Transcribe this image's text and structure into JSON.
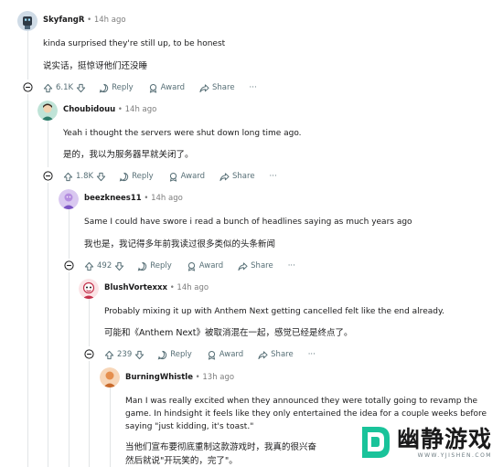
{
  "comments": [
    {
      "user": "SkyfangR",
      "time": "14h ago",
      "text_en": "kinda surprised they're still up, to be honest",
      "text_zh": "说实话，挺惊讶他们还没睡",
      "votes": "6.1K"
    },
    {
      "user": "Choubidouu",
      "time": "14h ago",
      "text_en": "Yeah i thought the servers were shut down long time ago.",
      "text_zh": "是的，我以为服务器早就关闭了。",
      "votes": "1.8K"
    },
    {
      "user": "beezknees11",
      "time": "14h ago",
      "text_en": "Same I could have swore i read a bunch of headlines saying as much years ago",
      "text_zh": "我也是，我记得多年前我读过很多类似的头条新闻",
      "votes": "492"
    },
    {
      "user": "BlushVortexxx",
      "time": "14h ago",
      "text_en": "Probably mixing it up with Anthem Next getting cancelled felt like the end already.",
      "text_zh": "可能和《Anthem Next》被取消混在一起，感觉已经是终点了。",
      "votes": "239"
    },
    {
      "user": "BurningWhistle",
      "time": "13h ago",
      "text_en_1": "Man I was really excited when they announced they were totally going to revamp the",
      "text_en_2": "game. In hindsight it feels like they only entertained the idea for a couple weeks before",
      "text_en_3": "saying \"just kidding, it's toast.\"",
      "text_zh_1": "当他们宣布要彻底重制这款游戏时，我真的很兴奋",
      "text_zh_2": "然后就说\"开玩笑的，完了\"。"
    }
  ],
  "actions": {
    "reply": "Reply",
    "award": "Award",
    "share": "Share",
    "more": "···",
    "sep": "•"
  },
  "watermark": {
    "name": "幽静游戏",
    "url": "WWW.YJISHEN.COM"
  },
  "colors": {
    "accent": "#19c39a",
    "meta": "#576f76"
  }
}
